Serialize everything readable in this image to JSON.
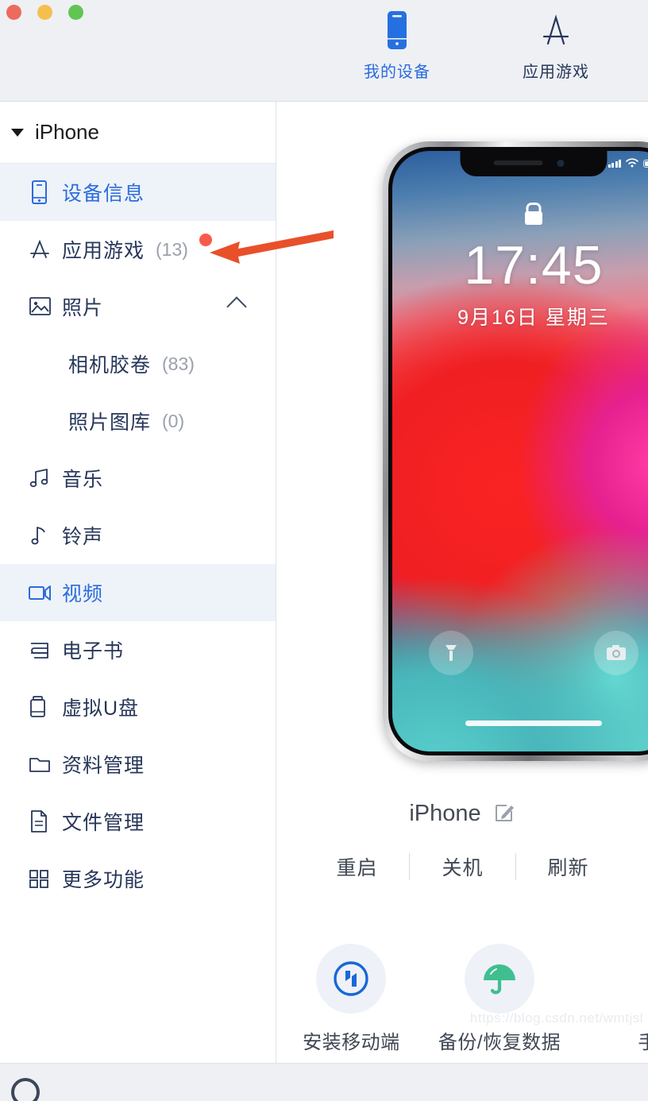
{
  "window": {
    "traffic_lights": [
      {
        "name": "close",
        "color": "#ec6a5e"
      },
      {
        "name": "minimize",
        "color": "#f5bf4f"
      },
      {
        "name": "zoom",
        "color": "#61c554"
      }
    ]
  },
  "header": {
    "tabs": [
      {
        "label": "我的设备",
        "icon": "phone-icon",
        "active": true,
        "color": "#2a6cdd"
      },
      {
        "label": "应用游戏",
        "icon": "app-store-icon",
        "active": false,
        "color": "#27375a"
      }
    ]
  },
  "sidebar": {
    "device_name": "iPhone",
    "items": [
      {
        "label": "设备信息",
        "icon": "device-info-icon",
        "count": "",
        "selected": true,
        "indent": false,
        "badge": false,
        "chevron": false
      },
      {
        "label": "应用游戏",
        "icon": "app-store-icon",
        "count": "(13)",
        "selected": false,
        "indent": false,
        "badge": true,
        "chevron": false
      },
      {
        "label": "照片",
        "icon": "photo-icon",
        "count": "",
        "selected": false,
        "indent": false,
        "badge": false,
        "chevron": true
      },
      {
        "label": "相机胶卷",
        "icon": "",
        "count": "(83)",
        "selected": false,
        "indent": true,
        "badge": false,
        "chevron": false
      },
      {
        "label": "照片图库",
        "icon": "",
        "count": "(0)",
        "selected": false,
        "indent": true,
        "badge": false,
        "chevron": false
      },
      {
        "label": "音乐",
        "icon": "music-icon",
        "count": "",
        "selected": false,
        "indent": false,
        "badge": false,
        "chevron": false
      },
      {
        "label": "铃声",
        "icon": "ringtone-icon",
        "count": "",
        "selected": false,
        "indent": false,
        "badge": false,
        "chevron": false
      },
      {
        "label": "视频",
        "icon": "video-icon",
        "count": "",
        "selected": true,
        "indent": false,
        "badge": false,
        "chevron": false
      },
      {
        "label": "电子书",
        "icon": "ebook-icon",
        "count": "",
        "selected": false,
        "indent": false,
        "badge": false,
        "chevron": false
      },
      {
        "label": "虚拟U盘",
        "icon": "usb-drive-icon",
        "count": "",
        "selected": false,
        "indent": false,
        "badge": false,
        "chevron": false
      },
      {
        "label": "资料管理",
        "icon": "folder-icon",
        "count": "",
        "selected": false,
        "indent": false,
        "badge": false,
        "chevron": false
      },
      {
        "label": "文件管理",
        "icon": "file-icon",
        "count": "",
        "selected": false,
        "indent": false,
        "badge": false,
        "chevron": false
      },
      {
        "label": "更多功能",
        "icon": "grid-icon",
        "count": "",
        "selected": false,
        "indent": false,
        "badge": false,
        "chevron": false
      }
    ]
  },
  "device_preview": {
    "lockscreen": {
      "time": "17:45",
      "date": "9月16日 星期三",
      "lock_icon": "lock-icon",
      "flashlight_icon": "flashlight-icon",
      "camera_icon": "camera-icon"
    },
    "device_name": "iPhone",
    "rename_icon": "edit-icon",
    "actions": [
      {
        "label": "重启",
        "name": "restart-button"
      },
      {
        "label": "关机",
        "name": "shutdown-button"
      },
      {
        "label": "刷新",
        "name": "refresh-button"
      }
    ]
  },
  "quick_actions": [
    {
      "label": "安装移动端",
      "icon": "install-mobile-icon",
      "color": "#1868d6"
    },
    {
      "label": "备份/恢复数据",
      "icon": "umbrella-icon",
      "color": "#3fbf8f"
    },
    {
      "label": "手",
      "icon": "partial-icon",
      "color": "#8b8f98"
    }
  ],
  "watermark": "https://blog.csdn.net/wmtjsl",
  "annotation": {
    "arrow_color": "#e8502a",
    "points_to": "应用游戏"
  }
}
